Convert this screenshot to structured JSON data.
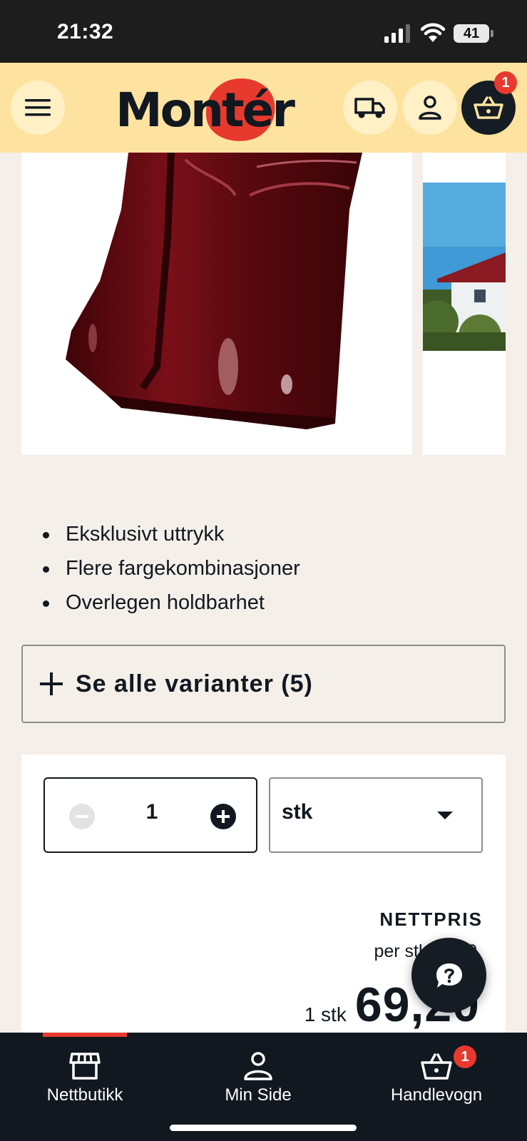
{
  "status_bar": {
    "time": "21:32",
    "battery": "41"
  },
  "header": {
    "logo_text": "Montér",
    "logo_registered": "®",
    "cart_count": "1",
    "icons": [
      "menu-icon",
      "truck-icon",
      "user-icon",
      "basket-icon"
    ]
  },
  "product": {
    "features": [
      "Eksklusivt uttrykk",
      "Flere fargekombinasjoner",
      "Overlegen holdbarhet"
    ],
    "variants_button": "Se alle varianter (5)"
  },
  "purchase": {
    "quantity": "1",
    "unit": "stk",
    "price_label": "NETTPRIS",
    "per_unit_text": "per stk 69,20",
    "price_qty": "1 stk",
    "price_value": "69,20"
  },
  "bottom_nav": {
    "items": [
      {
        "label": "Nettbutikk",
        "icon": "store-icon",
        "active": true
      },
      {
        "label": "Min Side",
        "icon": "user-icon",
        "active": false
      },
      {
        "label": "Handlevogn",
        "icon": "basket-icon",
        "active": false
      }
    ],
    "cart_count": "1"
  },
  "colors": {
    "brand_red": "#e8392f",
    "header_yellow": "#fde39f",
    "dark": "#111820",
    "background": "#f4efe9",
    "tile_red": "#6b0d14"
  }
}
